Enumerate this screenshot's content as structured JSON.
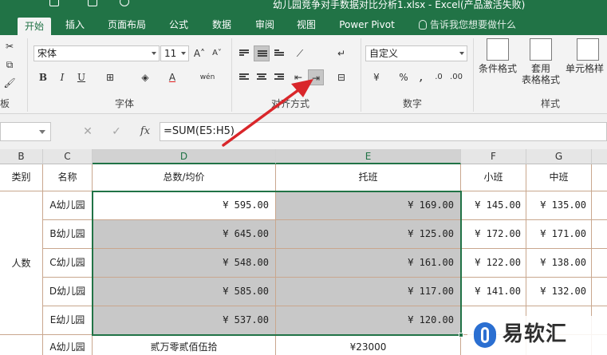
{
  "window": {
    "title": "幼儿园竞争对手数据对比分析1.xlsx - Excel(产品激活失败)"
  },
  "tabs": [
    "开始",
    "插入",
    "页面布局",
    "公式",
    "数据",
    "审阅",
    "视图",
    "Power Pivot"
  ],
  "tell_me": "告诉我您想要做什么",
  "ribbon": {
    "font_name": "宋体",
    "font_size": "11",
    "number_format": "自定义",
    "groups": {
      "clipboard": "板",
      "font": "字体",
      "alignment": "对齐方式",
      "number": "数字",
      "styles": "样式"
    },
    "buttons": {
      "bold": "B",
      "italic": "I",
      "underline": "U",
      "grow": "A˄",
      "shrink": "A˅",
      "wen": "wén",
      "percent": "%",
      "comma": ",",
      "currency": "¥",
      "cond_format": "条件格式",
      "table_format_1": "套用",
      "table_format_2": "表格格式",
      "cell_styles": "单元格样"
    }
  },
  "formula_bar": {
    "name_box": "",
    "formula": "=SUM(E5:H5)",
    "cancel": "✕",
    "enter": "✓",
    "fx": "fx"
  },
  "grid": {
    "columns": [
      "B",
      "C",
      "D",
      "E",
      "F",
      "G"
    ],
    "headers": [
      "类别",
      "名称",
      "总数/均价",
      "托班",
      "小班",
      "中班"
    ],
    "category": "人数",
    "rows": [
      {
        "name": "A幼儿园",
        "total": "¥ 595.00",
        "tuo": "¥ 169.00",
        "xiao": "¥  145.00",
        "zhong": "¥  135.00"
      },
      {
        "name": "B幼儿园",
        "total": "¥ 645.00",
        "tuo": "¥ 125.00",
        "xiao": "¥  172.00",
        "zhong": "¥  171.00"
      },
      {
        "name": "C幼儿园",
        "total": "¥ 548.00",
        "tuo": "¥ 161.00",
        "xiao": "¥  122.00",
        "zhong": "¥  138.00"
      },
      {
        "name": "D幼儿园",
        "total": "¥ 585.00",
        "tuo": "¥ 117.00",
        "xiao": "¥  141.00",
        "zhong": "¥  132.00"
      },
      {
        "name": "E幼儿园",
        "total": "¥ 537.00",
        "tuo": "¥ 120.00",
        "xiao": "",
        "zhong": ""
      }
    ],
    "last_row": {
      "name": "A幼儿园",
      "total": "贰万零贰佰伍拾",
      "tuo": "¥23000"
    }
  },
  "watermark": "易软汇",
  "colors": {
    "accent": "#217346",
    "arrow": "#d9262a",
    "selected_fill": "#c8c8c8"
  }
}
